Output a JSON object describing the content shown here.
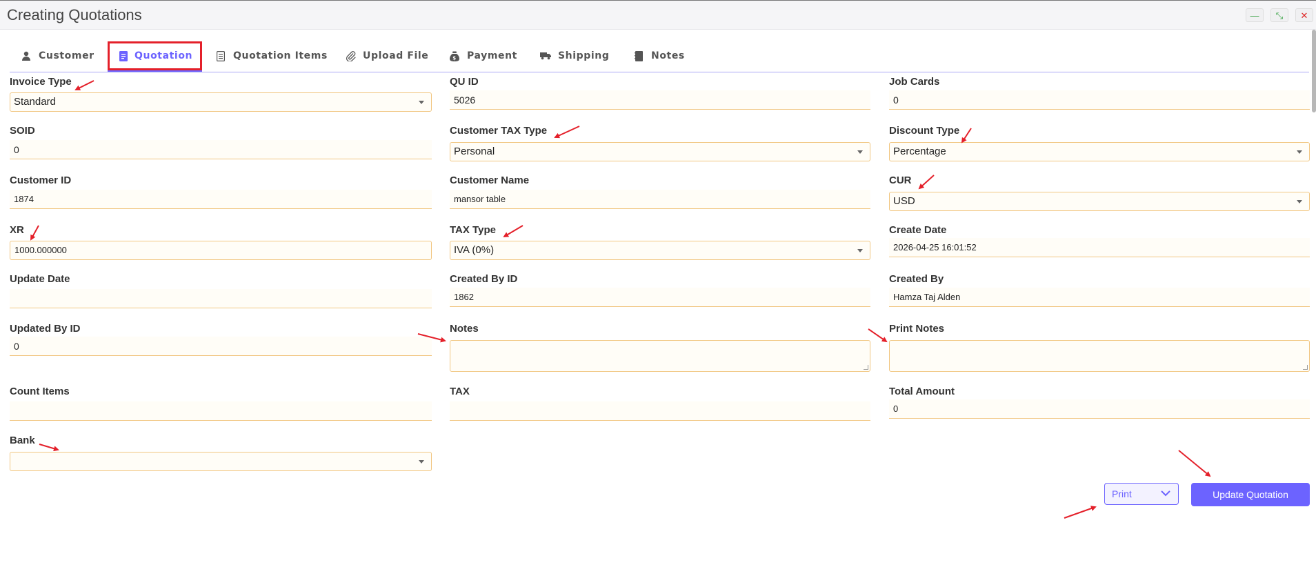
{
  "window": {
    "title": "Creating Quotations",
    "minimize_glyph": "—",
    "restore_glyph": "⤡",
    "close_glyph": "✕"
  },
  "tabs": [
    {
      "label": "Customer",
      "icon": "user-icon",
      "active": false
    },
    {
      "label": "Quotation",
      "icon": "document-icon",
      "active": true
    },
    {
      "label": "Quotation Items",
      "icon": "list-icon",
      "active": false
    },
    {
      "label": "Upload File",
      "icon": "paperclip-icon",
      "active": false
    },
    {
      "label": "Payment",
      "icon": "money-bag-icon",
      "active": false
    },
    {
      "label": "Shipping",
      "icon": "truck-icon",
      "active": false
    },
    {
      "label": "Notes",
      "icon": "notebook-icon",
      "active": false
    }
  ],
  "form": {
    "invoice_type": {
      "label": "Invoice Type",
      "value": "Standard"
    },
    "qu_id": {
      "label": "QU ID",
      "value": "5026"
    },
    "job_cards": {
      "label": "Job Cards",
      "value": "0"
    },
    "soid": {
      "label": "SOID",
      "value": "0"
    },
    "customer_tax_type": {
      "label": "Customer TAX Type",
      "value": "Personal"
    },
    "discount_type": {
      "label": "Discount Type",
      "value": "Percentage"
    },
    "customer_id": {
      "label": "Customer ID",
      "value": "1874"
    },
    "customer_name": {
      "label": "Customer Name",
      "value": "mansor table"
    },
    "cur": {
      "label": "CUR",
      "value": "USD"
    },
    "xr": {
      "label": "XR",
      "value": "1000.000000"
    },
    "tax_type": {
      "label": "TAX Type",
      "value": "IVA (0%)"
    },
    "create_date": {
      "label": "Create Date",
      "value": "2026-04-25 16:01:52"
    },
    "update_date": {
      "label": "Update Date",
      "value": ""
    },
    "created_by_id": {
      "label": "Created By ID",
      "value": "1862"
    },
    "created_by": {
      "label": "Created By",
      "value": "Hamza Taj Alden"
    },
    "updated_by_id": {
      "label": "Updated By ID",
      "value": "0"
    },
    "notes": {
      "label": "Notes",
      "value": ""
    },
    "print_notes": {
      "label": "Print Notes",
      "value": ""
    },
    "count_items": {
      "label": "Count Items",
      "value": ""
    },
    "tax": {
      "label": "TAX",
      "value": ""
    },
    "total_amount": {
      "label": "Total Amount",
      "value": "0"
    },
    "bank": {
      "label": "Bank",
      "value": ""
    }
  },
  "actions": {
    "print_label": "Print",
    "update_label": "Update Quotation"
  },
  "colors": {
    "accent": "#6c63ff",
    "field_border": "#f1c681",
    "highlight": "#e4202a"
  }
}
